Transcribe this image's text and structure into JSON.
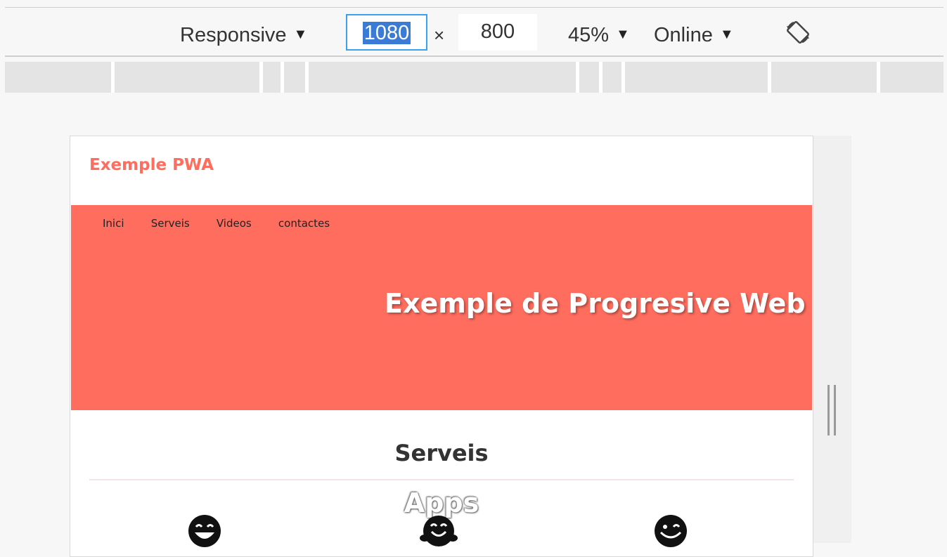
{
  "toolbar": {
    "device_label": "Responsive",
    "width_value": "1080",
    "height_value": "800",
    "times_symbol": "×",
    "zoom_label": "45%",
    "network_label": "Online",
    "caret": "▼",
    "rotate_icon": "rotate-icon"
  },
  "page": {
    "brand": "Exemple PWA",
    "nav": [
      "Inici",
      "Serveis",
      "Videos",
      "contactes"
    ],
    "hero_title": "Exemple de Progresive Web",
    "section_title": "Serveis",
    "apps_label": "Apps",
    "colors": {
      "accent": "#ff6d5e",
      "highlight": "#3a7bd5"
    },
    "icons": [
      "grinning-face-icon",
      "hugging-face-icon",
      "winking-face-icon"
    ]
  }
}
